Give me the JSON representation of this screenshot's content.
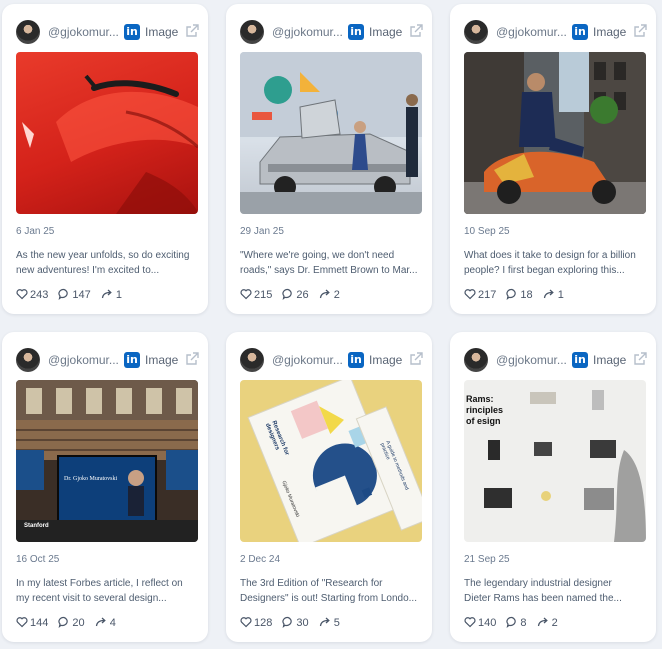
{
  "colors": {
    "background": "#eef1f6",
    "card": "#ffffff",
    "linkedin_blue": "#0a66c2",
    "text_muted": "#6b7a8f"
  },
  "posts": [
    {
      "handle": "@gjokomur...",
      "source_icon": "linkedin-icon",
      "type": "Image",
      "date": "6 Jan 25",
      "excerpt": [
        "As the new year unfolds, so do exciting",
        "new adventures! I'm excited to..."
      ],
      "likes": "243",
      "comments": "147",
      "shares": "1"
    },
    {
      "handle": "@gjokomur...",
      "source_icon": "linkedin-icon",
      "type": "Image",
      "date": "29 Jan 25",
      "excerpt": [
        "\"Where we're going, we don't need",
        "roads,\" says Dr. Emmett Brown to Mar..."
      ],
      "likes": "215",
      "comments": "26",
      "shares": "2"
    },
    {
      "handle": "@gjokomur...",
      "source_icon": "linkedin-icon",
      "type": "Image",
      "date": "10 Sep 25",
      "excerpt": [
        "What does it take to design for a billion",
        "people? I first began exploring this..."
      ],
      "likes": "217",
      "comments": "18",
      "shares": "1"
    },
    {
      "handle": "@gjokomur...",
      "source_icon": "linkedin-icon",
      "type": "Image",
      "date": "16 Oct 25",
      "excerpt": [
        "In my latest Forbes article, I reflect on",
        "my recent visit to several design..."
      ],
      "likes": "144",
      "comments": "20",
      "shares": "4"
    },
    {
      "handle": "@gjokomur...",
      "source_icon": "linkedin-icon",
      "type": "Image",
      "date": "2 Dec 24",
      "excerpt": [
        "The 3rd Edition of \"Research for",
        "Designers\" is out! Starting from Londo..."
      ],
      "likes": "128",
      "comments": "30",
      "shares": "5"
    },
    {
      "handle": "@gjokomur...",
      "source_icon": "linkedin-icon",
      "type": "Image",
      "date": "21 Sep 25",
      "excerpt": [
        "The legendary industrial designer",
        "Dieter Rams has been named the..."
      ],
      "likes": "140",
      "comments": "8",
      "shares": "2"
    }
  ],
  "media_text": {
    "post4_slide_title": "Dr. Gjoko Muratovski",
    "post4_logo": "Stanford",
    "post5_book_title": "Research for designers",
    "post5_book_subtitle": "A guide to methods and practice",
    "post5_author": "Gjoko Muratovski",
    "post6_heading": "Rams: rinciples of esign"
  }
}
